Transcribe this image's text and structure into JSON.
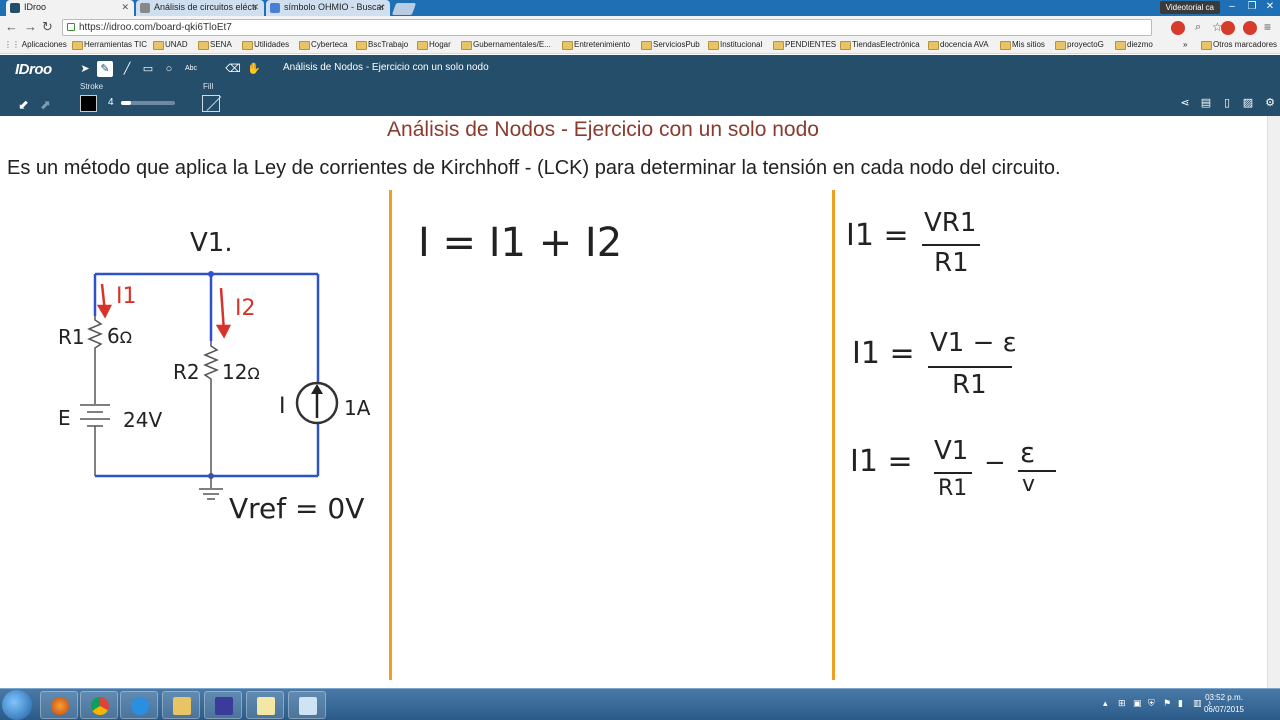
{
  "browser": {
    "tabs": [
      {
        "label": "IDroo",
        "active": true
      },
      {
        "label": "Análisis de circuitos eléctr",
        "active": false
      },
      {
        "label": "símbolo OHMIO - Buscar",
        "active": false
      }
    ],
    "window_user": "Videotorial ca",
    "url": "https://idroo.com/board-qki6TloEt7",
    "bookmarks": [
      "Aplicaciones",
      "Herramientas TIC",
      "UNAD",
      "SENA",
      "Utilidades",
      "Cyberteca",
      "BscTrabajo",
      "Hogar",
      "Gubernamentales/E...",
      "Entretenimiento",
      "ServiciosPub",
      "Institucional",
      "PENDIENTES",
      "TiendasElectrónica",
      "docencia AVA",
      "Mis sitios",
      "proyectoG",
      "diezmo"
    ],
    "bookmarks_more": "»",
    "other_bookmarks": "Otros marcadores"
  },
  "app": {
    "logo": "IDroo",
    "board_title": "Análisis de Nodos - Ejercicio con un solo nodo",
    "stroke_label": "Stroke",
    "stroke_value": "4",
    "fill_label": "Fill",
    "text_tool": "Abc"
  },
  "board": {
    "heading": "Análisis de Nodos - Ejercicio con un solo nodo",
    "description": "Es un método que aplica la Ley de corrientes de Kirchhoff  - (LCK) para determinar la tensión en cada nodo del circuito.",
    "circuit": {
      "node_label": "V1.",
      "i1": "I1",
      "i2": "I2",
      "r1": "R1",
      "r1_value": "6",
      "r2": "R2",
      "r2_value": "12",
      "ohm": "Ω",
      "source_e": "E",
      "source_e_value": "24V",
      "source_i": "I",
      "source_i_value": "1A",
      "vref": "Vref = 0V"
    },
    "equation_middle": "I = I1 + I2",
    "equations_right": [
      {
        "lhs": "I1 =",
        "num": "VR1",
        "den": "R1"
      },
      {
        "lhs": "I1 =",
        "num": "V1 − ε",
        "den": "R1"
      },
      {
        "lhs": "I1 =",
        "num": "V1",
        "den": "R1",
        "minus": "−",
        "num2": "ε",
        "den2": "v"
      }
    ]
  },
  "taskbar": {
    "time": "03:52 p.m.",
    "date": "06/07/2015"
  },
  "colors": {
    "tab_strip": "#1f6fb5",
    "idroo_bar": "#254e6a",
    "heading": "#8b3b2e",
    "divider": "#f0a020",
    "wire": "#2f53c6",
    "current_arrow": "#d8332a"
  }
}
